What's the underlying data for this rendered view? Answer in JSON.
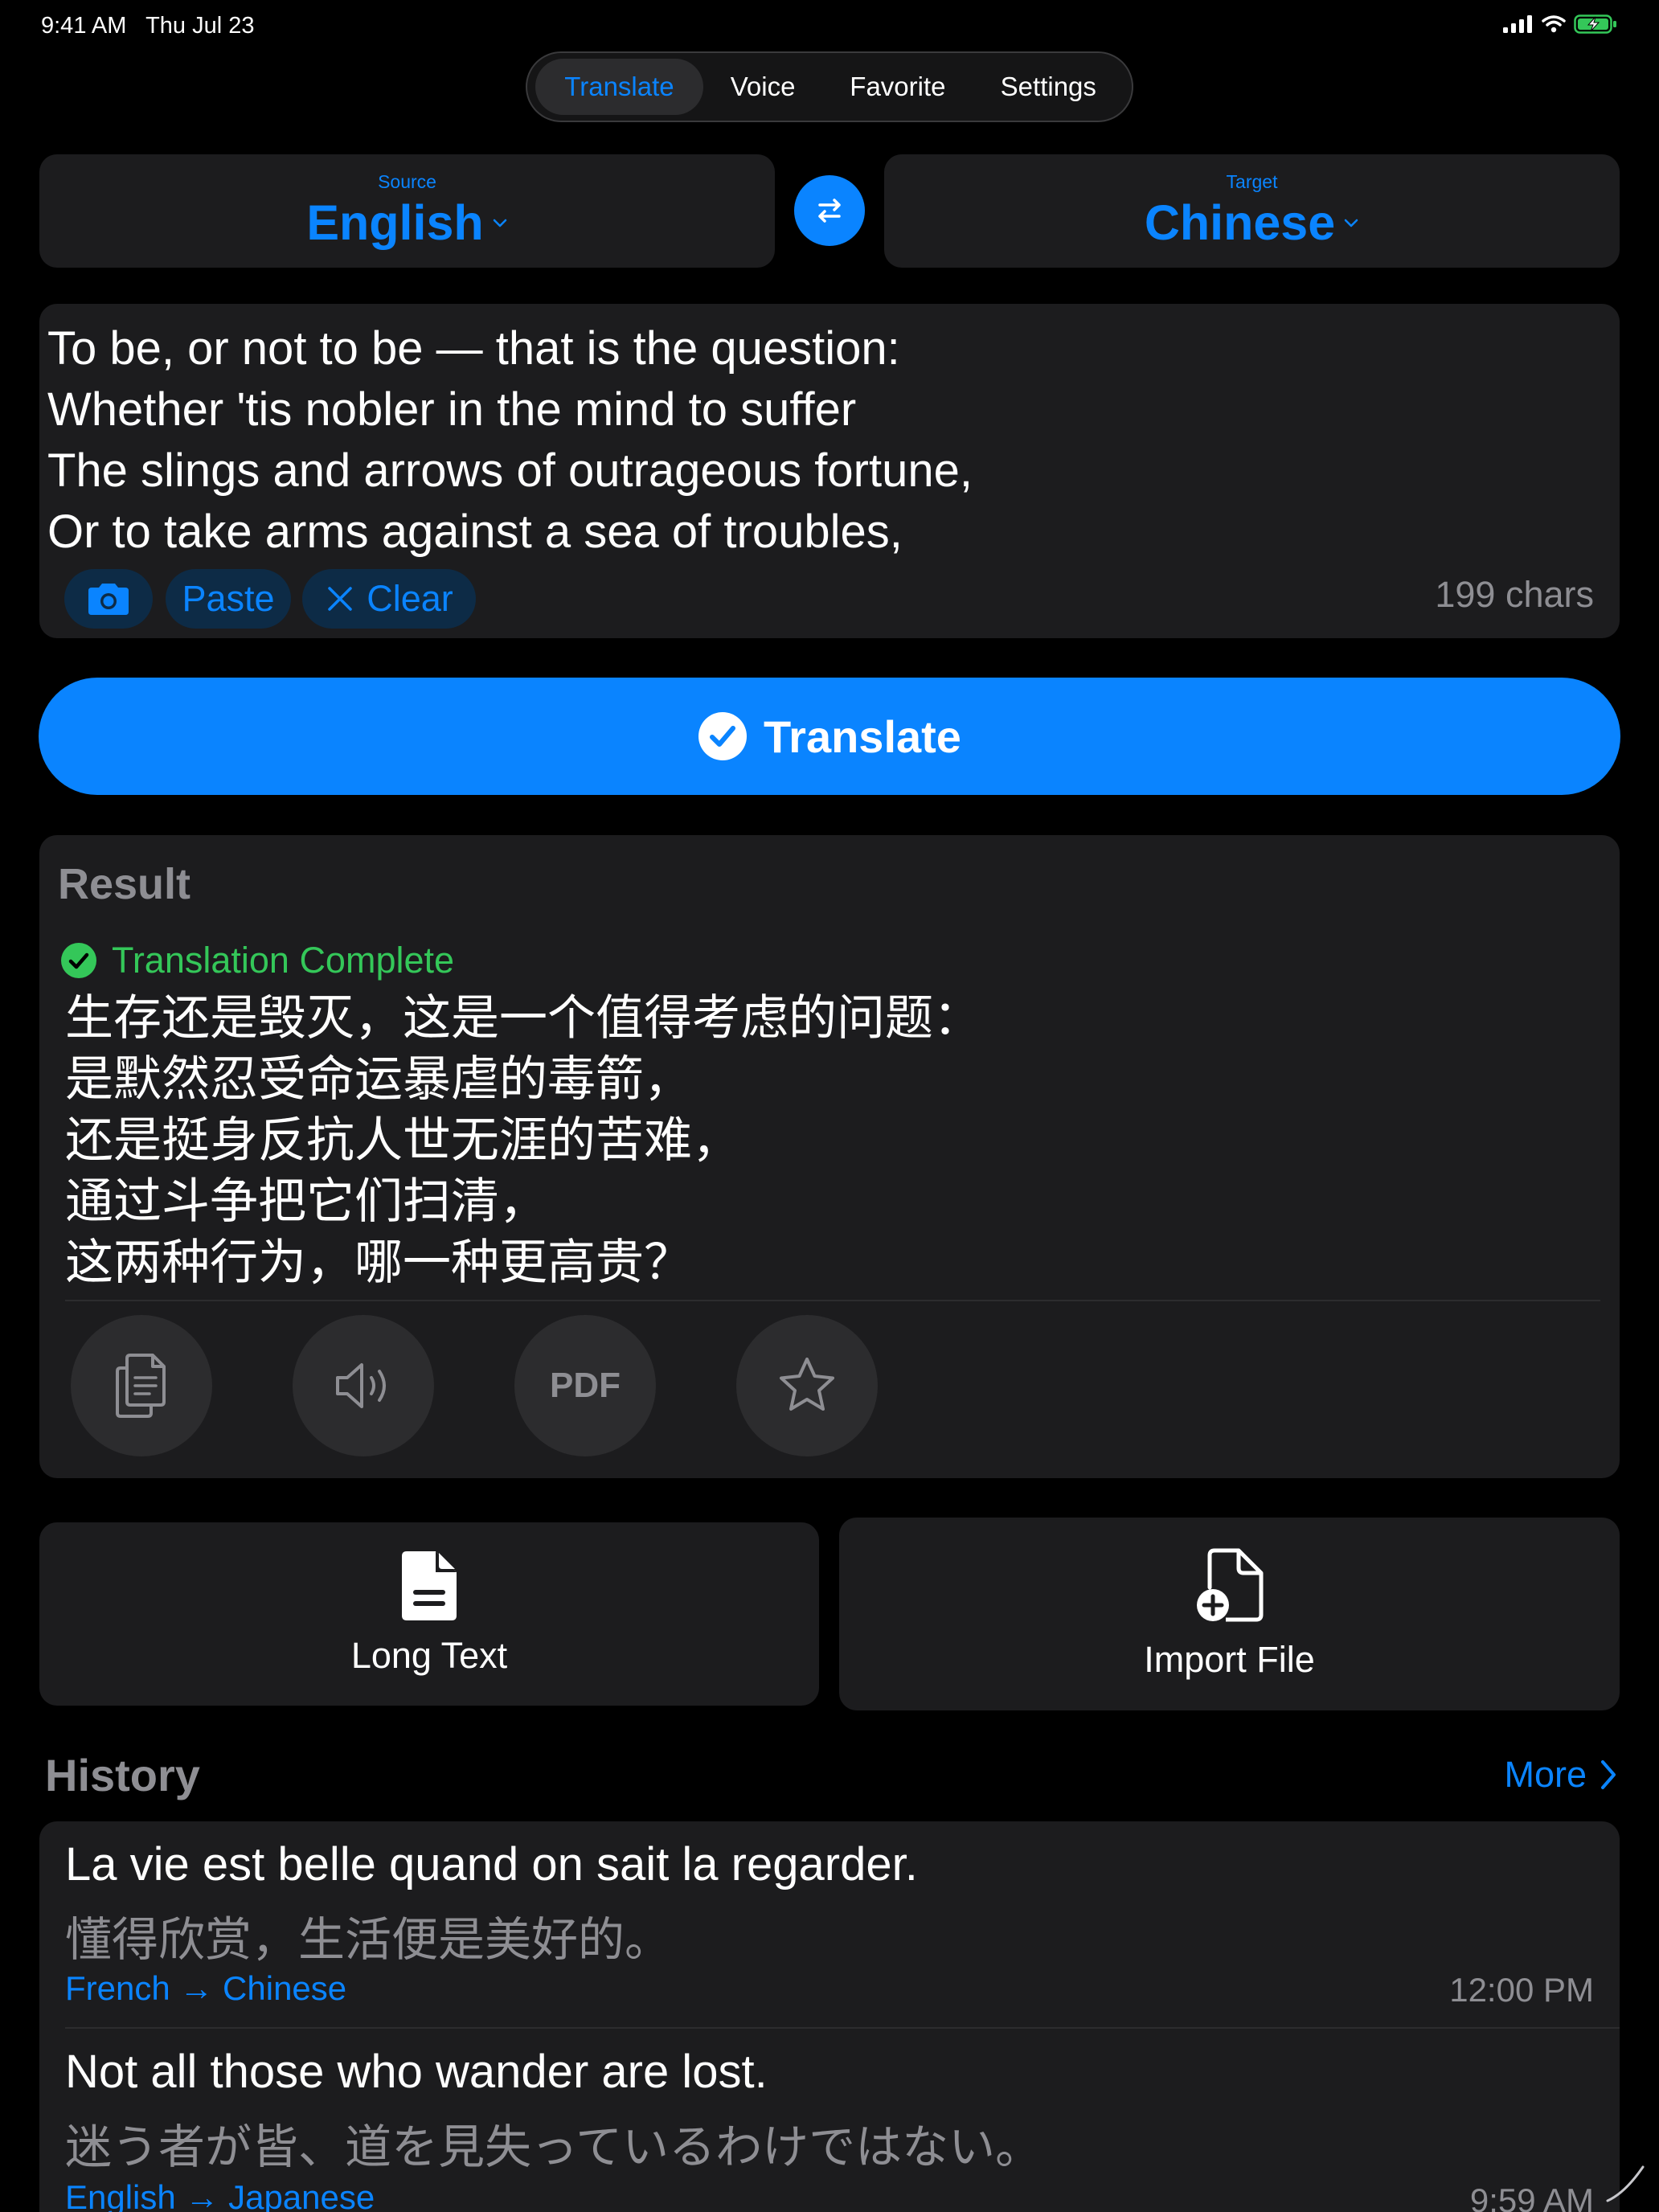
{
  "status_bar": {
    "time": "9:41 AM",
    "date": "Thu Jul 23"
  },
  "nav": {
    "tabs": [
      "Translate",
      "Voice",
      "Favorite",
      "Settings"
    ],
    "active": "Translate"
  },
  "languages": {
    "source_caption": "Source",
    "source": "English",
    "target_caption": "Target",
    "target": "Chinese"
  },
  "input": {
    "text": "To be, or not to be — that is the question:\nWhether 'tis nobler in the mind to suffer\nThe slings and arrows of outrageous fortune,\nOr to take arms against a sea of troubles,",
    "paste_label": "Paste",
    "clear_label": "Clear",
    "char_count": "199 chars"
  },
  "translate_button": {
    "label": "Translate"
  },
  "result": {
    "title": "Result",
    "status": "Translation Complete",
    "text": "生存还是毁灭，这是一个值得考虑的问题：\n是默然忍受命运暴虐的毒箭，\n还是挺身反抗人世无涯的苦难，\n通过斗争把它们扫清，\n这两种行为，哪一种更高贵？",
    "pdf_label": "PDF"
  },
  "features": {
    "long_text": "Long Text",
    "import_file": "Import File"
  },
  "history": {
    "title": "History",
    "more_label": "More",
    "items": [
      {
        "source": "La vie est belle quand on sait la regarder.",
        "translation": "懂得欣赏，生活便是美好的。",
        "pair": "French → Chinese",
        "time": "12:00 PM"
      },
      {
        "source": "Not all those who wander are lost.",
        "translation": "迷う者が皆、道を見失っているわけではない。",
        "pair": "English → Japanese",
        "time": "9:59 AM"
      }
    ]
  },
  "colors": {
    "accent": "#0a84ff",
    "success": "#34c759",
    "card": "#1c1c1e",
    "muted": "#8e8e93"
  }
}
